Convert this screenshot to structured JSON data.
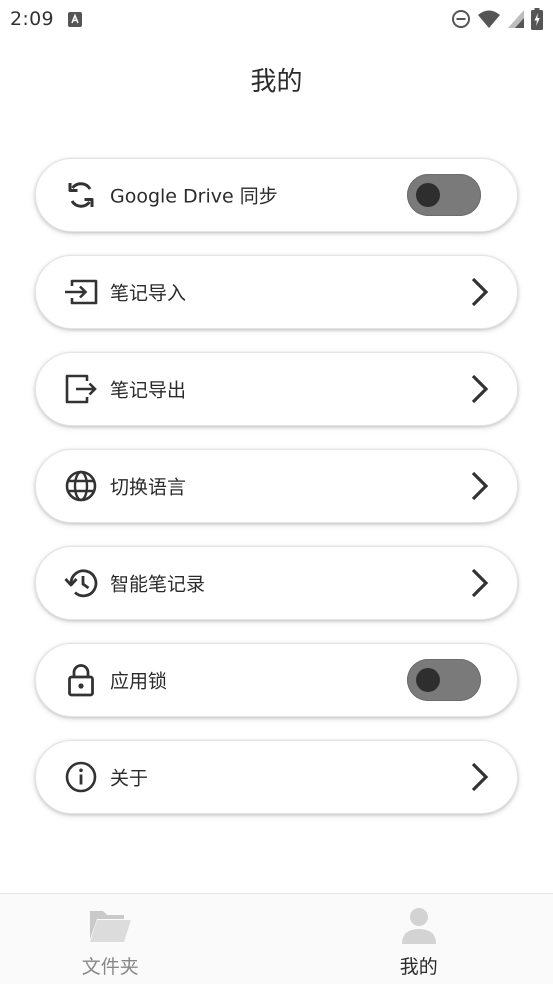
{
  "status_bar": {
    "time": "2:09"
  },
  "header": {
    "title": "我的"
  },
  "settings": [
    {
      "label": "Google Drive 同步",
      "icon": "sync-icon",
      "control": "toggle",
      "enabled": false
    },
    {
      "label": "笔记导入",
      "icon": "import-icon",
      "control": "chevron"
    },
    {
      "label": "笔记导出",
      "icon": "export-icon",
      "control": "chevron"
    },
    {
      "label": "切换语言",
      "icon": "globe-icon",
      "control": "chevron"
    },
    {
      "label": "智能笔记录",
      "icon": "history-icon",
      "control": "chevron"
    },
    {
      "label": "应用锁",
      "icon": "lock-icon",
      "control": "toggle",
      "enabled": false
    },
    {
      "label": "关于",
      "icon": "info-icon",
      "control": "chevron"
    }
  ],
  "bottom_nav": {
    "items": [
      {
        "label": "文件夹",
        "icon": "folder-icon",
        "active": false
      },
      {
        "label": "我的",
        "icon": "person-icon",
        "active": true
      }
    ]
  },
  "colors": {
    "toggle_track": "#7a7a7a",
    "toggle_knob": "#2e2e2e",
    "text": "#2b2b2b",
    "inactive_nav": "#888888"
  }
}
